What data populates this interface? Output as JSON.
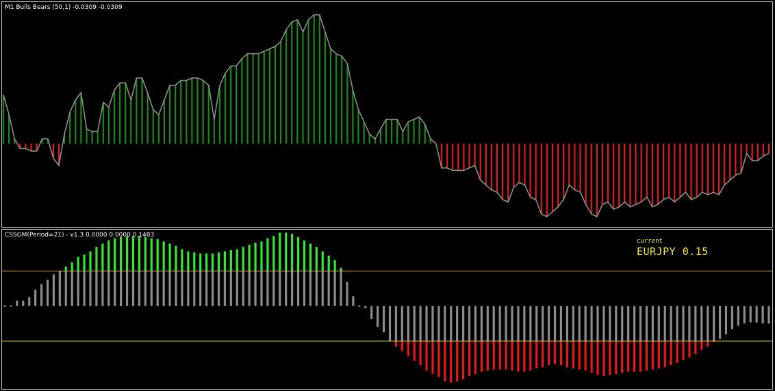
{
  "colors": {
    "background": "#000000",
    "border": "#c8c8c8",
    "bull_bar": "#1a8a1a",
    "bear_bar": "#e01c1c",
    "outline": "#8f8f8f",
    "css_bright_green": "#33e833",
    "css_gray": "#8c8c8c",
    "css_red": "#e81818",
    "level_line": "#d8b85a",
    "current_text": "#f5e642"
  },
  "pane1": {
    "label_name": "M1 Bulls Bears (50,1)",
    "label_values": "-0.0309 -0.0309"
  },
  "pane2": {
    "label_name": "CSSGM(Period=21) - v1.3",
    "label_values": "0.0000 0.0000 0.1483",
    "current_caption": "current",
    "current_symbol": "EURJPY",
    "current_value": "0.15"
  },
  "chart_data": [
    {
      "type": "bar",
      "title": "M1 Bulls Bears (50,1)",
      "ylim": [
        -0.32,
        0.56
      ],
      "grid": false,
      "values": [
        0.2,
        0.12,
        0.02,
        -0.02,
        -0.02,
        -0.03,
        -0.03,
        0.02,
        0.02,
        -0.06,
        -0.09,
        0.04,
        0.13,
        0.18,
        0.21,
        0.06,
        0.05,
        0.05,
        0.17,
        0.15,
        0.22,
        0.25,
        0.25,
        0.18,
        0.27,
        0.27,
        0.21,
        0.14,
        0.12,
        0.18,
        0.24,
        0.24,
        0.26,
        0.26,
        0.27,
        0.27,
        0.26,
        0.24,
        0.1,
        0.24,
        0.29,
        0.32,
        0.32,
        0.35,
        0.37,
        0.37,
        0.37,
        0.38,
        0.39,
        0.4,
        0.42,
        0.47,
        0.5,
        0.51,
        0.46,
        0.51,
        0.53,
        0.53,
        0.46,
        0.39,
        0.37,
        0.36,
        0.33,
        0.22,
        0.14,
        0.09,
        0.04,
        0.02,
        0.06,
        0.1,
        0.1,
        0.1,
        0.05,
        0.09,
        0.1,
        0.11,
        0.08,
        0.02,
        0.0,
        -0.1,
        -0.1,
        -0.11,
        -0.11,
        -0.11,
        -0.1,
        -0.09,
        -0.15,
        -0.17,
        -0.19,
        -0.2,
        -0.23,
        -0.24,
        -0.18,
        -0.16,
        -0.17,
        -0.22,
        -0.23,
        -0.29,
        -0.3,
        -0.28,
        -0.26,
        -0.23,
        -0.17,
        -0.19,
        -0.2,
        -0.25,
        -0.29,
        -0.3,
        -0.25,
        -0.24,
        -0.27,
        -0.26,
        -0.24,
        -0.26,
        -0.25,
        -0.24,
        -0.22,
        -0.26,
        -0.25,
        -0.23,
        -0.22,
        -0.24,
        -0.22,
        -0.2,
        -0.23,
        -0.22,
        -0.2,
        -0.21,
        -0.2,
        -0.21,
        -0.17,
        -0.15,
        -0.13,
        -0.12,
        -0.04,
        -0.07,
        -0.07,
        -0.05,
        -0.04
      ]
    },
    {
      "type": "bar",
      "title": "CSSGM(Period=21) - v1.3",
      "ylim": [
        -0.72,
        0.66
      ],
      "levels": [
        0.32,
        -0.32
      ],
      "grid": false,
      "values": [
        0.0,
        0.0,
        0.05,
        0.05,
        0.08,
        0.15,
        0.2,
        0.24,
        0.29,
        0.32,
        0.36,
        0.4,
        0.45,
        0.47,
        0.5,
        0.54,
        0.57,
        0.6,
        0.62,
        0.63,
        0.64,
        0.64,
        0.64,
        0.63,
        0.62,
        0.61,
        0.59,
        0.57,
        0.55,
        0.52,
        0.5,
        0.49,
        0.48,
        0.48,
        0.48,
        0.49,
        0.5,
        0.51,
        0.52,
        0.54,
        0.56,
        0.58,
        0.59,
        0.62,
        0.64,
        0.67,
        0.67,
        0.66,
        0.63,
        0.6,
        0.57,
        0.54,
        0.5,
        0.46,
        0.42,
        0.35,
        0.22,
        0.09,
        0.0,
        -0.02,
        -0.12,
        -0.19,
        -0.24,
        -0.32,
        -0.37,
        -0.41,
        -0.46,
        -0.5,
        -0.54,
        -0.59,
        -0.62,
        -0.65,
        -0.69,
        -0.7,
        -0.69,
        -0.67,
        -0.64,
        -0.62,
        -0.6,
        -0.59,
        -0.58,
        -0.58,
        -0.58,
        -0.59,
        -0.6,
        -0.6,
        -0.59,
        -0.57,
        -0.56,
        -0.54,
        -0.53,
        -0.54,
        -0.56,
        -0.57,
        -0.58,
        -0.59,
        -0.61,
        -0.63,
        -0.64,
        -0.63,
        -0.62,
        -0.61,
        -0.6,
        -0.6,
        -0.6,
        -0.59,
        -0.58,
        -0.57,
        -0.56,
        -0.54,
        -0.52,
        -0.49,
        -0.47,
        -0.44,
        -0.4,
        -0.37,
        -0.33,
        -0.3,
        -0.26,
        -0.21,
        -0.18,
        -0.16,
        -0.15,
        -0.15,
        -0.16,
        -0.16
      ]
    }
  ]
}
